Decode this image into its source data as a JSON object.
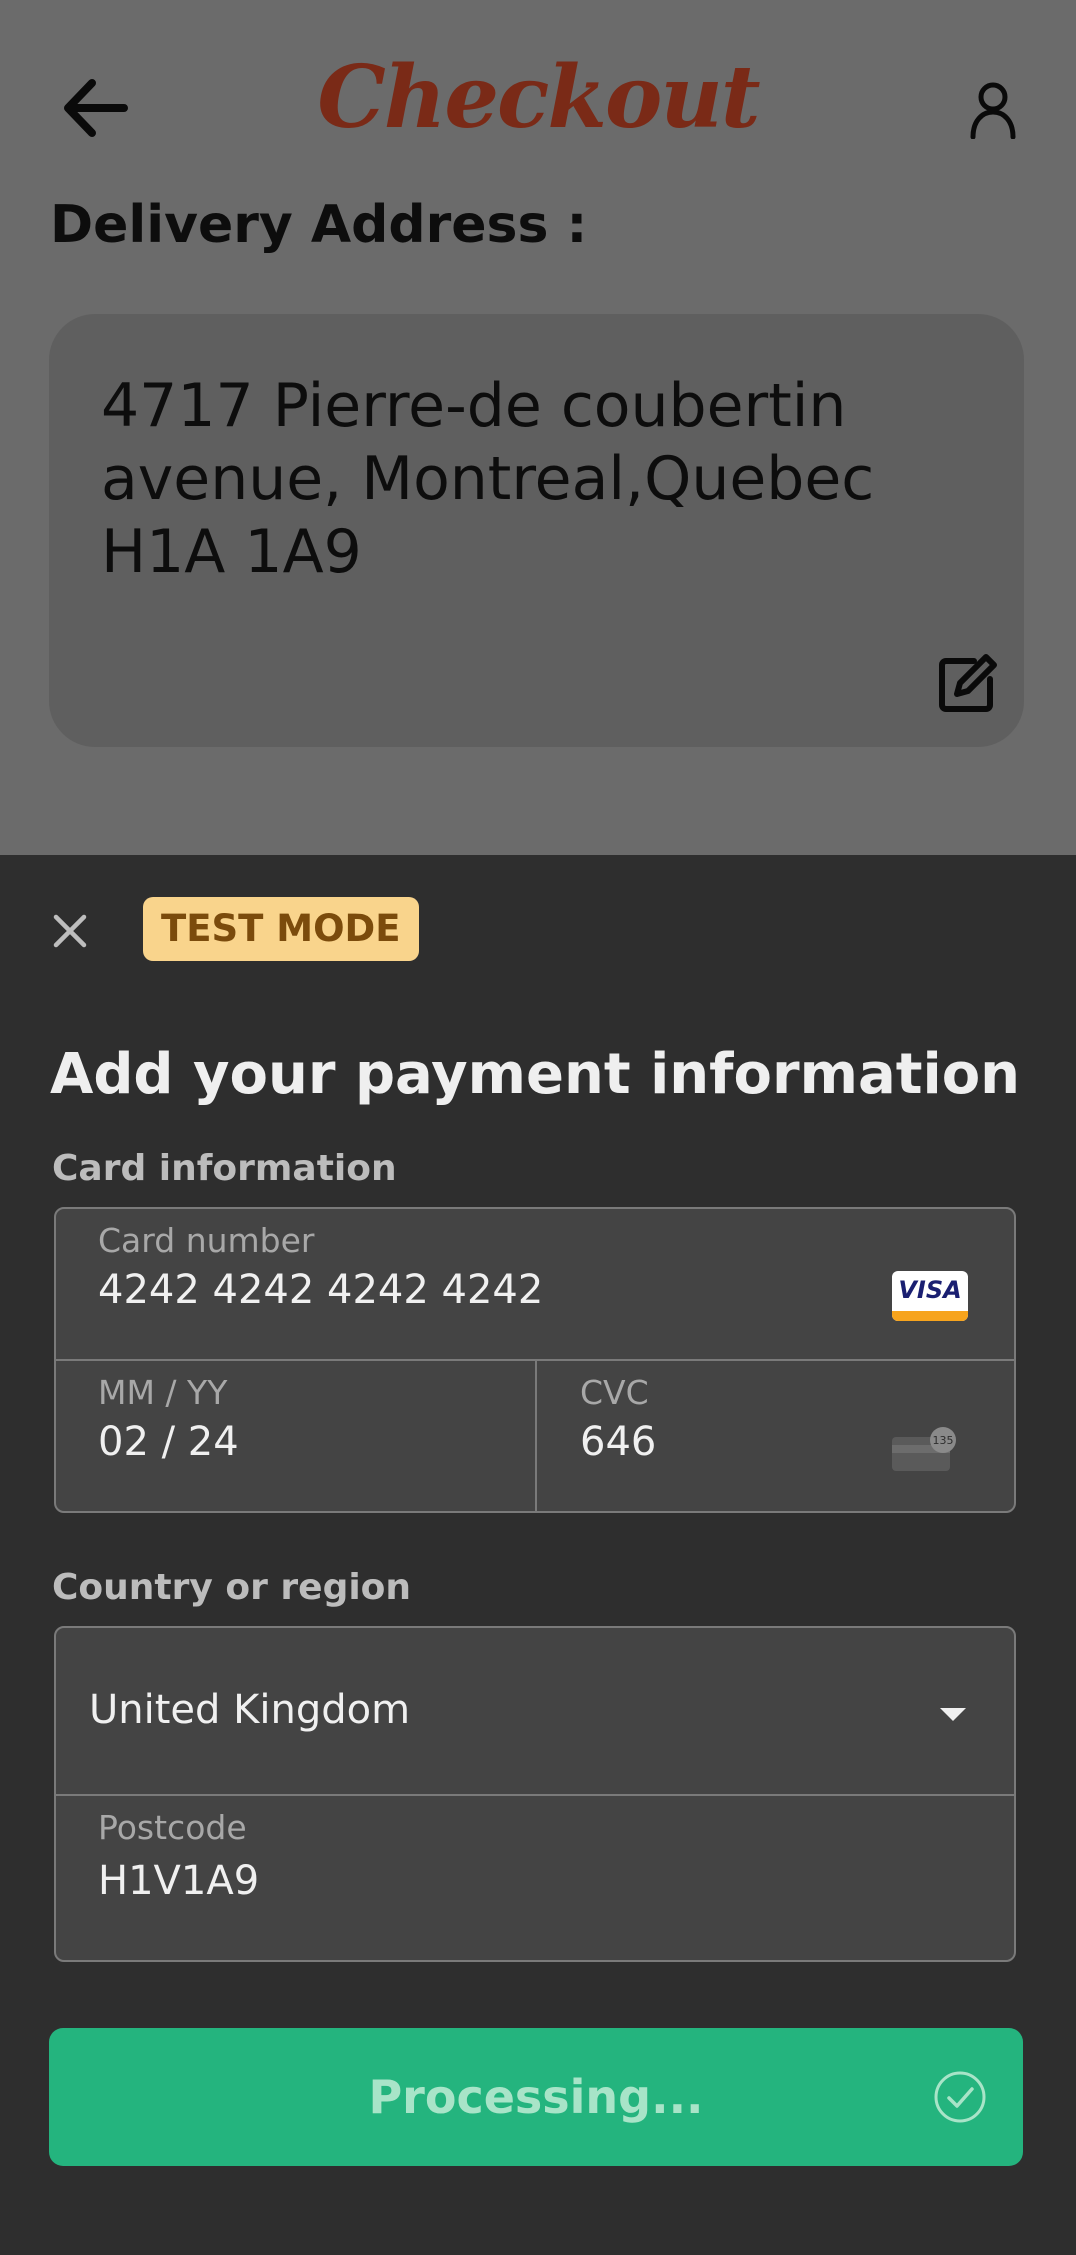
{
  "header": {
    "title": "Checkout",
    "back_icon": "arrow-left-icon",
    "profile_icon": "user-icon"
  },
  "delivery": {
    "label": "Delivery Address :",
    "address": "4717 Pierre-de coubertin avenue, Montreal,Quebec H1A 1A9",
    "edit_icon": "edit-icon"
  },
  "payment_sheet": {
    "close_icon": "close-icon",
    "badge": "TEST MODE",
    "title": "Add your payment information",
    "card_section_label": "Card information",
    "card_number_label": "Card number",
    "card_number_value": "4242 4242 4242 4242",
    "card_brand": "VISA",
    "expiry_label": "MM / YY",
    "expiry_value": "02 / 24",
    "cvc_label": "CVC",
    "cvc_value": "646",
    "cvc_hint": "135",
    "country_section_label": "Country or region",
    "country_value": "United Kingdom",
    "postcode_label": "Postcode",
    "postcode_value": "H1V1A9",
    "submit_label": "Processing..."
  },
  "colors": {
    "overlay": "#6b6b6b",
    "title_brand": "#7a2a17",
    "sheet_bg": "#2e2e2e",
    "input_bg": "#444444",
    "badge_bg": "#f9d48c",
    "badge_text": "#7b4b0c",
    "button_bg": "#24b47e",
    "button_text": "#a8e4c8"
  }
}
